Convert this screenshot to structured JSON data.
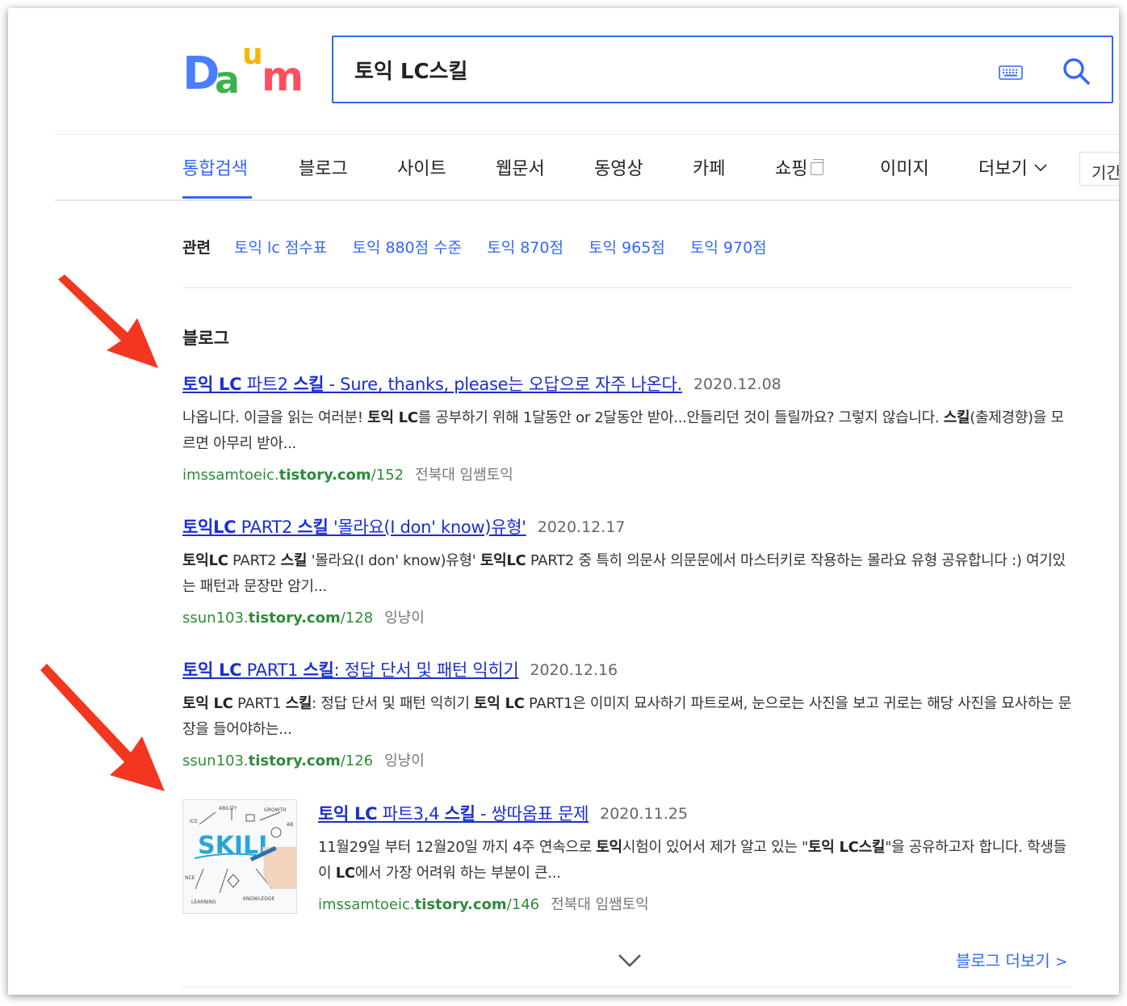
{
  "logo": {
    "letters": [
      "D",
      "a",
      "u",
      "m"
    ],
    "colors": {
      "D": "#4a7dff",
      "a": "#f7b500",
      "u": "#ff6a3d",
      "m": "#ff4f5e",
      "accent": "#3cb34a"
    }
  },
  "search": {
    "value": "토익 LC스킬",
    "keyboard_icon": "keyboard-icon",
    "search_icon": "search-icon"
  },
  "tabs": [
    {
      "label": "통합검색",
      "active": true
    },
    {
      "label": "블로그"
    },
    {
      "label": "사이트"
    },
    {
      "label": "웹문서"
    },
    {
      "label": "동영상"
    },
    {
      "label": "카페"
    },
    {
      "label": "쇼핑"
    },
    {
      "label": "이미지"
    },
    {
      "label": "더보기"
    }
  ],
  "period_label": "기간",
  "related": {
    "label": "관련",
    "items": [
      "토익 lc 점수표",
      "토익 880점 수준",
      "토익 870점",
      "토익 965점",
      "토익 970점"
    ]
  },
  "blog": {
    "section_title": "블로그",
    "results": [
      {
        "title_parts": [
          {
            "t": "토익 LC",
            "b": true
          },
          {
            "t": " 파트2 ",
            "b": false
          },
          {
            "t": "스킬",
            "b": true
          },
          {
            "t": " - Sure, thanks, please는 오답으로 자주 나온다.",
            "b": false
          }
        ],
        "date": "2020.12.08",
        "desc_parts": [
          {
            "t": "나옵니다. 이글을 읽는 여러분! ",
            "b": false
          },
          {
            "t": "토익 LC",
            "b": true
          },
          {
            "t": "를 공부하기 위해 1달동안 or 2달동안 받아...안들리던 것이 들릴까요? 그렇지 않습니다. ",
            "b": false
          },
          {
            "t": "스킬",
            "b": true
          },
          {
            "t": "(출제경향)을 모르면 아무리 받아...",
            "b": false
          }
        ],
        "url_prefix": "imssamtoeic.",
        "url_domain": "tistory.com",
        "url_path": "/152",
        "source": "전북대 임쌤토익"
      },
      {
        "title_parts": [
          {
            "t": "토익LC",
            "b": true
          },
          {
            "t": " PART2 ",
            "b": false
          },
          {
            "t": "스킬",
            "b": true
          },
          {
            "t": " '몰라요(I don' know)유형'",
            "b": false
          }
        ],
        "date": "2020.12.17",
        "desc_parts": [
          {
            "t": "토익LC",
            "b": true
          },
          {
            "t": " PART2 ",
            "b": false
          },
          {
            "t": "스킬",
            "b": true
          },
          {
            "t": " '몰라요(I don' know)유형' ",
            "b": false
          },
          {
            "t": "토익LC",
            "b": true
          },
          {
            "t": " PART2 중 특히 의문사 의문문에서 마스터키로 작용하는 몰라요 유형 공유합니다 :) 여기있는 패턴과 문장만 암기...",
            "b": false
          }
        ],
        "url_prefix": "ssun103.",
        "url_domain": "tistory.com",
        "url_path": "/128",
        "source": "잉냥이"
      },
      {
        "title_parts": [
          {
            "t": "토익 LC",
            "b": true
          },
          {
            "t": " PART1 ",
            "b": false
          },
          {
            "t": "스킬",
            "b": true
          },
          {
            "t": ": 정답 단서 및 패턴 익히기",
            "b": false
          }
        ],
        "date": "2020.12.16",
        "desc_parts": [
          {
            "t": "토익 LC",
            "b": true
          },
          {
            "t": " PART1 ",
            "b": false
          },
          {
            "t": "스킬",
            "b": true
          },
          {
            "t": ": 정답 단서 및 패턴 익히기 ",
            "b": false
          },
          {
            "t": "토익 LC",
            "b": true
          },
          {
            "t": " PART1은 이미지 묘사하기 파트로써, 눈으로는 사진을 보고 귀로는 해당 사진을 묘사하는 문장을 들어야하는...",
            "b": false
          }
        ],
        "url_prefix": "ssun103.",
        "url_domain": "tistory.com",
        "url_path": "/126",
        "source": "잉냥이"
      },
      {
        "title_parts": [
          {
            "t": "토익 LC",
            "b": true
          },
          {
            "t": " 파트3,4 ",
            "b": false
          },
          {
            "t": "스킬",
            "b": true
          },
          {
            "t": " - 쌍따옴표 문제",
            "b": false
          }
        ],
        "date": "2020.11.25",
        "desc_parts": [
          {
            "t": "11월29일 부터 12월20일 까지 4주 연속으로 ",
            "b": false
          },
          {
            "t": "토익",
            "b": true
          },
          {
            "t": "시험이 있어서 제가 알고 있는 \"",
            "b": false
          },
          {
            "t": "토익 LC스킬",
            "b": true
          },
          {
            "t": "\"을 공유하고자 합니다. 학생들이 ",
            "b": false
          },
          {
            "t": "LC",
            "b": true
          },
          {
            "t": "에서 가장 어려워 하는 부분이 큰...",
            "b": false
          }
        ],
        "url_prefix": "imssamtoeic.",
        "url_domain": "tistory.com",
        "url_path": "/146",
        "source": "전북대 임쌤토익",
        "thumbnail": {
          "main": "SKILL",
          "words": [
            "ABILITY",
            "GROWTH",
            "LEARNING",
            "KNOWLEDGE",
            "ICE",
            "NCE",
            "AB"
          ]
        }
      }
    ],
    "more_label": "블로그 더보기"
  },
  "colors": {
    "accent": "#3366ff",
    "link": "#1a2ed0",
    "url_green": "#2e8b3a",
    "arrow_red": "#f2361f"
  }
}
